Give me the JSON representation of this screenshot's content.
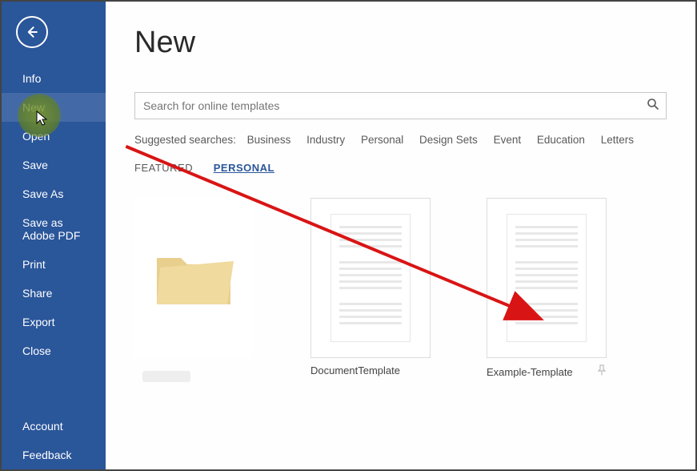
{
  "sidebar": {
    "items": [
      {
        "label": "Info"
      },
      {
        "label": "New"
      },
      {
        "label": "Open"
      },
      {
        "label": "Save"
      },
      {
        "label": "Save As"
      },
      {
        "label": "Save as Adobe PDF"
      },
      {
        "label": "Print"
      },
      {
        "label": "Share"
      },
      {
        "label": "Export"
      },
      {
        "label": "Close"
      }
    ],
    "bottom": [
      {
        "label": "Account"
      },
      {
        "label": "Feedback"
      }
    ]
  },
  "page": {
    "title": "New",
    "search_placeholder": "Search for online templates"
  },
  "suggested": {
    "label": "Suggested searches:",
    "links": [
      "Business",
      "Industry",
      "Personal",
      "Design Sets",
      "Event",
      "Education",
      "Letters"
    ]
  },
  "tabs": {
    "featured": "FEATURED",
    "personal": "PERSONAL"
  },
  "templates": [
    {
      "label": ""
    },
    {
      "label": "DocumentTemplate"
    },
    {
      "label": "Example-Template"
    }
  ],
  "colors": {
    "brand": "#2a569a",
    "arrow": "#d91414"
  }
}
